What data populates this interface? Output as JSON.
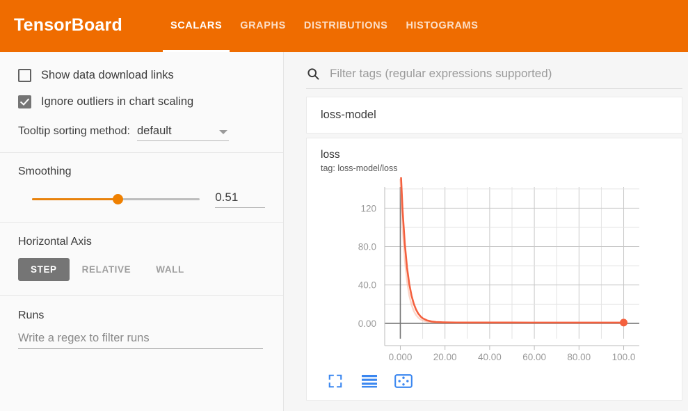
{
  "header": {
    "brand": "TensorBoard",
    "tabs": [
      {
        "label": "SCALARS",
        "active": true
      },
      {
        "label": "GRAPHS",
        "active": false
      },
      {
        "label": "DISTRIBUTIONS",
        "active": false
      },
      {
        "label": "HISTOGRAMS",
        "active": false
      }
    ],
    "accent_color": "#ef6c00"
  },
  "sidebar": {
    "checkboxes": [
      {
        "label": "Show data download links",
        "checked": false
      },
      {
        "label": "Ignore outliers in chart scaling",
        "checked": true
      }
    ],
    "tooltip": {
      "label": "Tooltip sorting method:",
      "value": "default",
      "icon": "chevron-down-icon"
    },
    "smoothing": {
      "title": "Smoothing",
      "value": "0.51",
      "fraction": 51,
      "track_color": "#bdbdbd",
      "fill_color": "#e8820c"
    },
    "horizontal_axis": {
      "title": "Horizontal Axis",
      "options": [
        {
          "label": "STEP",
          "active": true
        },
        {
          "label": "RELATIVE",
          "active": false
        },
        {
          "label": "WALL",
          "active": false
        }
      ]
    },
    "runs": {
      "title": "Runs",
      "placeholder": "Write a regex to filter runs",
      "value": ""
    }
  },
  "main": {
    "search": {
      "icon": "search-icon",
      "placeholder": "Filter tags (regular expressions supported)",
      "value": ""
    },
    "run_card_title": "loss-model",
    "chart": {
      "title": "loss",
      "tag": "tag: loss-model/loss",
      "actions": [
        {
          "name": "expand-chart-icon",
          "label": "fullscreen"
        },
        {
          "name": "data-table-icon",
          "label": "toggle-y-axis"
        },
        {
          "name": "data-dots-icon",
          "label": "toggle-data-dots"
        }
      ]
    }
  },
  "chart_data": {
    "type": "line",
    "title": "loss",
    "subtitle": "tag: loss-model/loss",
    "xlabel": "",
    "ylabel": "",
    "xlim": [
      -7,
      107
    ],
    "ylim": [
      -16,
      142
    ],
    "xticks": [
      "0.000",
      "20.00",
      "40.00",
      "60.00",
      "80.00",
      "100.0"
    ],
    "xtick_values": [
      0,
      20,
      40,
      60,
      80,
      100
    ],
    "yticks": [
      "0.00",
      "40.0",
      "80.0",
      "120"
    ],
    "ytick_values": [
      0,
      40,
      80,
      120
    ],
    "grid": true,
    "legend": "none",
    "series": [
      {
        "name": "loss (smoothed)",
        "color": "#f4603e",
        "width": 2.6,
        "opacity": 1,
        "x": [
          0,
          1,
          2,
          3,
          4,
          5,
          6,
          7,
          8,
          9,
          10,
          12,
          14,
          16,
          18,
          20,
          25,
          30,
          40,
          50,
          60,
          70,
          80,
          90,
          100
        ],
        "y": [
          168,
          118,
          83,
          58,
          41,
          29,
          20.5,
          14.5,
          10.2,
          7.3,
          5.3,
          3.0,
          1.9,
          1.4,
          1.15,
          1.0,
          0.85,
          0.8,
          0.78,
          0.77,
          0.76,
          0.76,
          0.75,
          0.75,
          0.75
        ]
      },
      {
        "name": "loss (raw)",
        "color": "#f9b49e",
        "width": 2.4,
        "opacity": 0.55,
        "x": [
          0,
          1,
          2,
          3,
          4,
          5,
          6,
          7,
          8,
          9,
          10,
          12,
          14,
          16,
          18,
          20,
          25,
          30,
          40,
          50,
          60,
          70,
          80,
          90,
          100
        ],
        "y": [
          150,
          100,
          66,
          44,
          29,
          19.5,
          13,
          8.8,
          6.0,
          4.2,
          3.0,
          1.7,
          1.1,
          0.9,
          0.82,
          0.78,
          0.74,
          0.72,
          0.7,
          0.7,
          0.7,
          0.7,
          0.7,
          0.7,
          0.7
        ]
      }
    ],
    "markers": [
      {
        "x": 100,
        "y": 0.75,
        "color": "#f4603e",
        "radius": 5.5
      }
    ],
    "axis_line_color": "#757575",
    "grid_color": "#c8c8c8",
    "minor_grid_color": "#e3e3e3",
    "tick_label_color": "#9a9a9a"
  }
}
